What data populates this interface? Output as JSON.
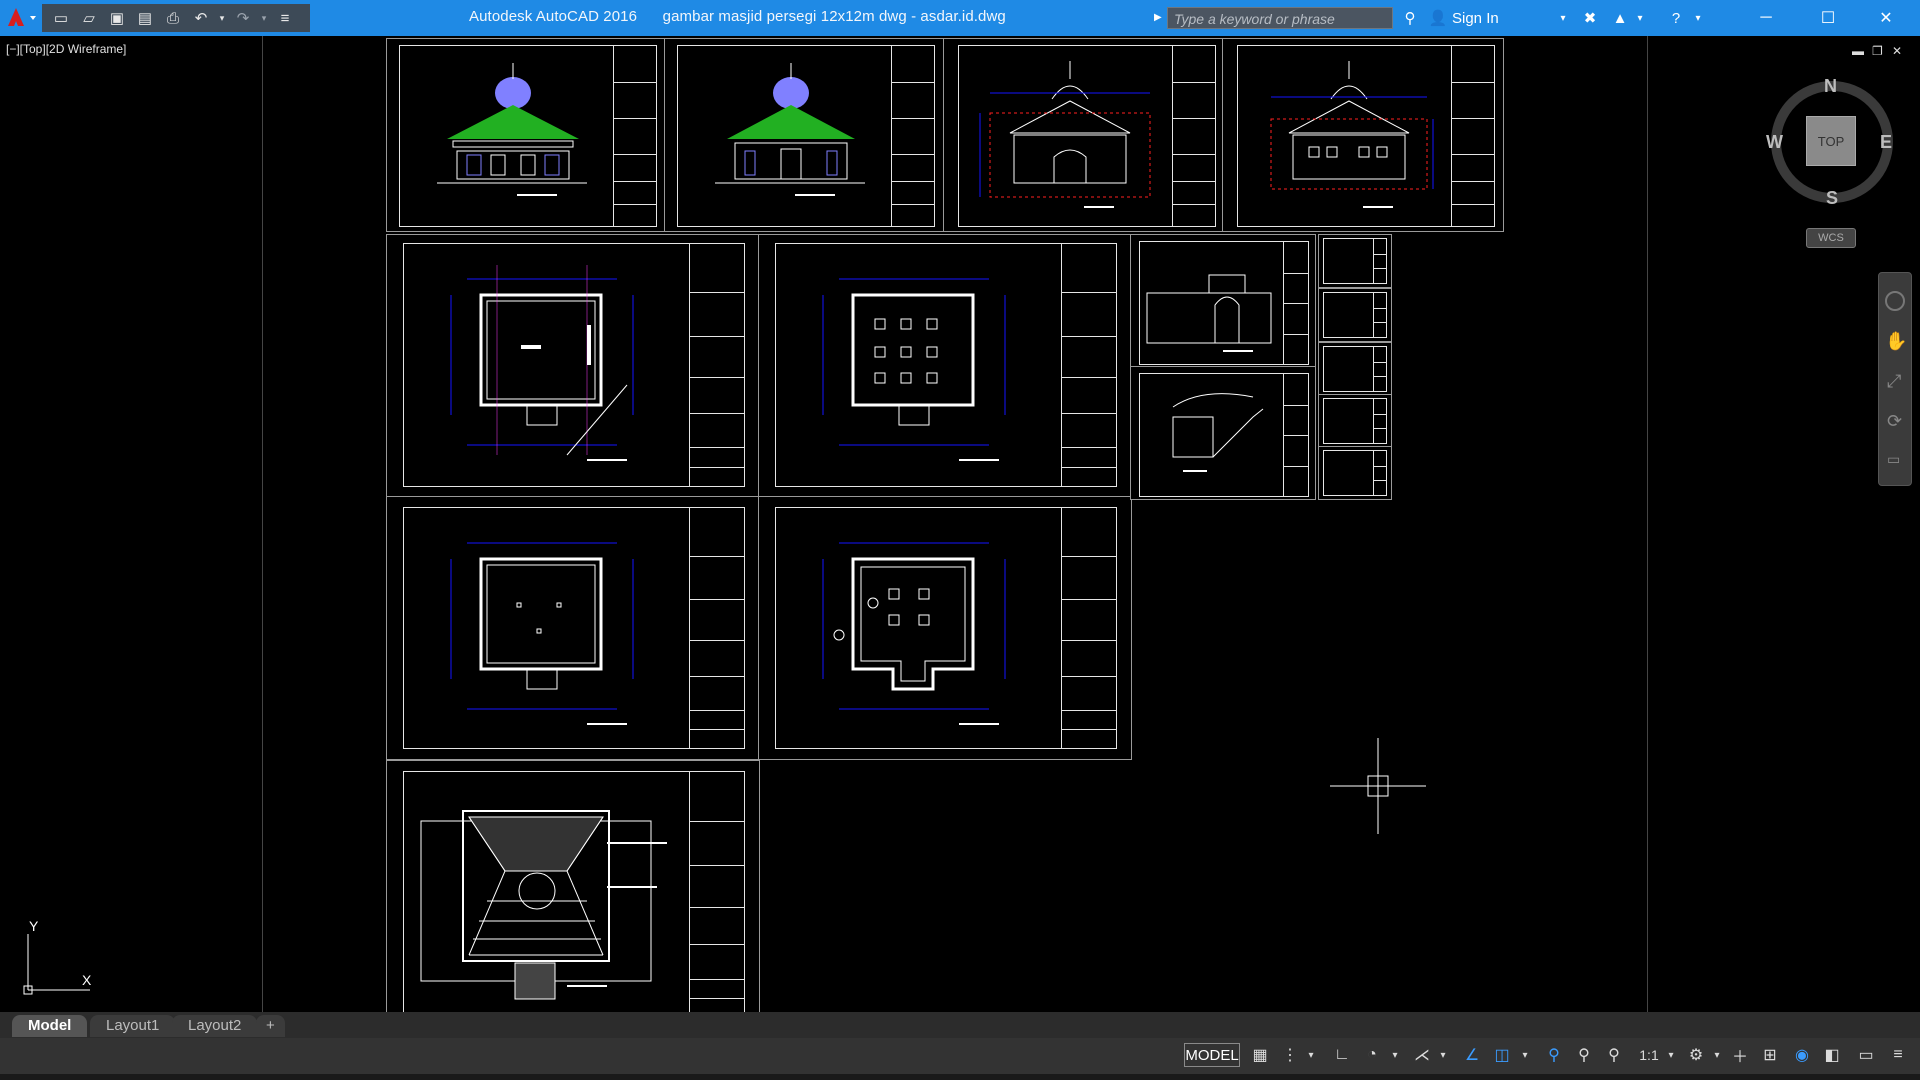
{
  "window": {
    "title": "Autodesk AutoCAD 2016      gambar masjid persegi 12x12m dwg - asdar.id.dwg",
    "minimize": "─",
    "maximize": "☐",
    "close": "✕"
  },
  "search": {
    "placeholder": "Type a keyword or phrase"
  },
  "header_buttons": {
    "sign_in": "Sign In"
  },
  "viewport": {
    "label": "[−][Top][2D Wireframe]"
  },
  "viewcube": {
    "north": "N",
    "south": "S",
    "east": "E",
    "west": "W",
    "top": "TOP",
    "wcs": "WCS"
  },
  "ucs": {
    "x": "X",
    "y": "Y"
  },
  "tabs": [
    "Model",
    "Layout1",
    "Layout2",
    "+"
  ],
  "status": {
    "model": "MODEL",
    "scale": "1:1"
  },
  "colors": {
    "titlebar": "#1f8ae5",
    "dome": "#7f7fff",
    "roof": "#22b022",
    "dimension_blue": "#1414ff",
    "dimension_red": "#ff2020"
  }
}
